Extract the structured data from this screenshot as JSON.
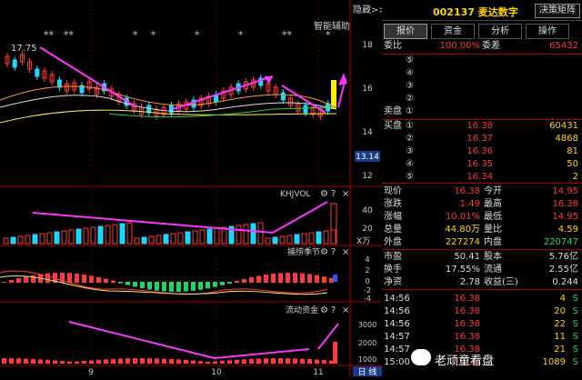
{
  "header": {
    "top_right_label": "隐藏>>",
    "stock_code": "002137",
    "stock_name": "麦达数字",
    "decision_button": "决策矩阵"
  },
  "chart": {
    "indicator_label": "智能辅助",
    "high_mark": "17.75",
    "price_axis": [
      "18",
      "16",
      "14",
      "12"
    ],
    "current_price_tag": "13.14",
    "date_labels": [
      "9",
      "10",
      "11"
    ],
    "vol_panel": {
      "label": "KHJVOL",
      "axis": [
        "40",
        "20"
      ],
      "unit": "X万"
    },
    "season_panel": {
      "label": "捕捞季节",
      "axis": [
        "4",
        "2",
        "0",
        "-2",
        "-4"
      ]
    },
    "flow_panel": {
      "label": "流动资金",
      "axis": [
        "3000",
        "2000",
        "1000"
      ]
    },
    "panel_icons": [
      "gear-icon",
      "question-icon",
      "close-icon"
    ],
    "period_tab": "日 线"
  },
  "tabs": [
    "报价",
    "资金",
    "分析",
    "操作"
  ],
  "commission": {
    "ratio_label": "委比",
    "ratio": "100.00%",
    "diff_label": "委差",
    "diff": "65432"
  },
  "asks": {
    "title": "卖盘",
    "levels": [
      "⑤",
      "④",
      "③",
      "②",
      "①"
    ]
  },
  "bids": {
    "title": "买盘",
    "rows": [
      {
        "level": "①",
        "price": "16.38",
        "vol": "60431"
      },
      {
        "level": "②",
        "price": "16.37",
        "vol": "4868"
      },
      {
        "level": "③",
        "price": "16.36",
        "vol": "81"
      },
      {
        "level": "④",
        "price": "16.35",
        "vol": "50"
      },
      {
        "level": "⑤",
        "price": "16.34",
        "vol": "2"
      }
    ]
  },
  "quote": [
    {
      "l1": "现价",
      "v1": "16.38",
      "l2": "今开",
      "v2": "14.95"
    },
    {
      "l1": "涨跌",
      "v1": "1.49",
      "l2": "最高",
      "v2": "16.38"
    },
    {
      "l1": "涨幅",
      "v1": "10.01%",
      "l2": "最低",
      "v2": "14.95"
    },
    {
      "l1": "总量",
      "v1": "44.80万",
      "l2": "量比",
      "v2": "4.59"
    },
    {
      "l1": "外盘",
      "v1": "227274",
      "l2": "内盘",
      "v2": "220747"
    }
  ],
  "fundamentals": [
    {
      "l1": "市盈",
      "v1": "50.41",
      "l2": "股本",
      "v2": "5.76亿"
    },
    {
      "l1": "换手",
      "v1": "17.55%",
      "l2": "流通",
      "v2": "2.55亿"
    },
    {
      "l1": "净资",
      "v1": "2.78",
      "l2": "收益(三)",
      "v2": "0.244"
    }
  ],
  "ticks": [
    {
      "time": "14:56",
      "price": "16.38",
      "vol": "4",
      "side": "S"
    },
    {
      "time": "14:56",
      "price": "16.38",
      "vol": "20",
      "side": "S"
    },
    {
      "time": "14:56",
      "price": "16.38",
      "vol": "22",
      "side": "S"
    },
    {
      "time": "14:57",
      "price": "16.38",
      "vol": "11",
      "side": "S"
    },
    {
      "time": "14:57",
      "price": "16.38",
      "vol": "21",
      "side": "S"
    },
    {
      "time": "15:00",
      "price": "16.38",
      "vol": "1089",
      "side": "S"
    }
  ],
  "watermark": "老顽童看盘",
  "colors": {
    "up": "#ff3b3b",
    "down": "#1ed7ff",
    "accent": "#ff33ff",
    "yellow": "#ffd400"
  }
}
